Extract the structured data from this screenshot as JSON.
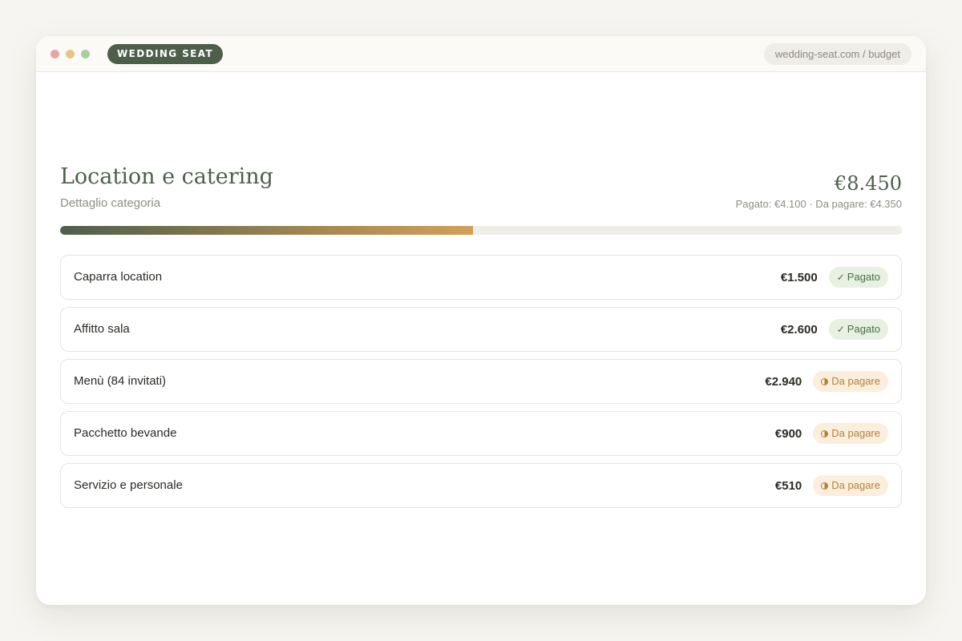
{
  "window": {
    "brand": "WEDDING SEAT",
    "url": "wedding-seat.com / budget"
  },
  "category": {
    "title": "Location e catering",
    "subtitle": "Dettaglio categoria",
    "total": "€8.450",
    "summary": "Pagato: €4.100 · Da pagare: €4.350",
    "paid_fraction": 0.49
  },
  "items": [
    {
      "name": "Caparra location",
      "amount": "€1.500",
      "status": "Pagato",
      "status_type": "paid",
      "icon": "check-icon"
    },
    {
      "name": "Affitto sala",
      "amount": "€2.600",
      "status": "Pagato",
      "status_type": "paid",
      "icon": "check-icon"
    },
    {
      "name": "Menù (84 invitati)",
      "amount": "€2.940",
      "status": "Da pagare",
      "status_type": "due",
      "icon": "clock-icon"
    },
    {
      "name": "Pacchetto bevande",
      "amount": "€900",
      "status": "Da pagare",
      "status_type": "due",
      "icon": "clock-icon"
    },
    {
      "name": "Servizio e personale",
      "amount": "€510",
      "status": "Da pagare",
      "status_type": "due",
      "icon": "clock-icon"
    }
  ],
  "colors": {
    "brand_green": "#4d5f4b",
    "accent_gold": "#d4a057",
    "paid_badge": "#e6f1e1",
    "due_badge": "#fbeedd"
  }
}
